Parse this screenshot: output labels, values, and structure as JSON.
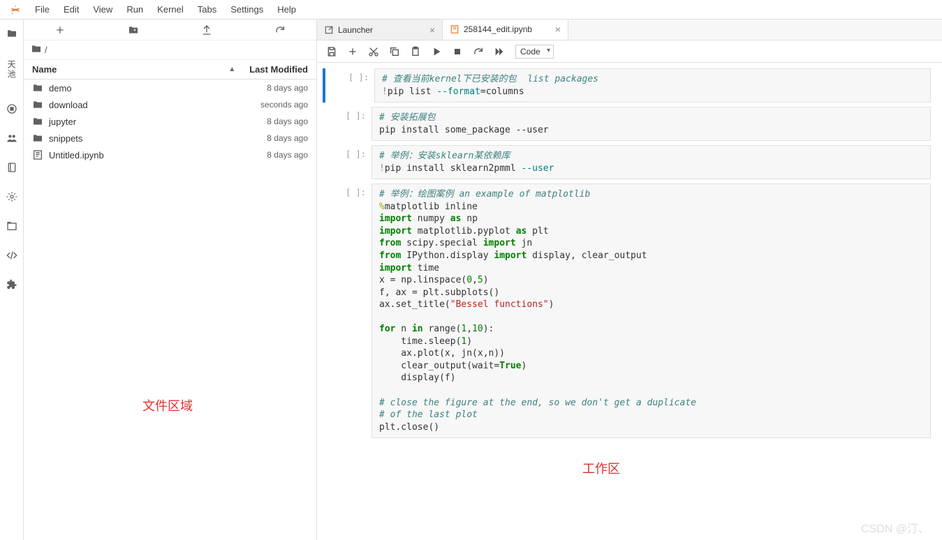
{
  "menu": {
    "items": [
      "File",
      "Edit",
      "View",
      "Run",
      "Kernel",
      "Tabs",
      "Settings",
      "Help"
    ]
  },
  "leftbar": {
    "label": "天池"
  },
  "filebrowser": {
    "crumb": "/",
    "header_name": "Name",
    "header_mod": "Last Modified",
    "rows": [
      {
        "icon": "folder",
        "name": "demo",
        "mod": "8 days ago"
      },
      {
        "icon": "folder",
        "name": "download",
        "mod": "seconds ago"
      },
      {
        "icon": "folder",
        "name": "jupyter",
        "mod": "8 days ago"
      },
      {
        "icon": "folder",
        "name": "snippets",
        "mod": "8 days ago"
      },
      {
        "icon": "notebook",
        "name": "Untitled.ipynb",
        "mod": "8 days ago"
      }
    ]
  },
  "tabs": [
    {
      "icon": "launch",
      "label": "Launcher",
      "active": false
    },
    {
      "icon": "notebook",
      "label": "258144_edit.ipynb",
      "active": true
    }
  ],
  "toolbar": {
    "celltype_selected": "Code"
  },
  "annotations": {
    "file_area": "文件区域",
    "work_area": "工作区"
  },
  "watermark": "CSDN @汀、",
  "cells": [
    {
      "prompt": "[ ]:",
      "running": true,
      "html": "<span class='c-cm'># 查看当前kernel下已安装的包  list packages</span>\n<span class='c-bang'>!</span>pip list <span class='c-teal'>--format</span>=columns"
    },
    {
      "prompt": "[ ]:",
      "html": "<span class='c-cm'># 安装拓展包</span>\npip install some_package --user"
    },
    {
      "prompt": "[ ]:",
      "html": "<span class='c-cm'># 举例：安装sklearn某依赖库</span>\n<span class='c-bang'>!</span>pip install sklearn2pmml <span class='c-teal'>--user</span>"
    },
    {
      "prompt": "[ ]:",
      "html": "<span class='c-cm'># 举例：绘图案例 an example of matplotlib</span>\n<span class='c-mg'>%</span>matplotlib inline\n<span class='c-kw'>import</span> numpy <span class='c-kw'>as</span> np\n<span class='c-kw'>import</span> matplotlib.pyplot <span class='c-kw'>as</span> plt\n<span class='c-kw'>from</span> scipy.special <span class='c-kw'>import</span> jn\n<span class='c-kw'>from</span> IPython.display <span class='c-kw'>import</span> display, clear_output\n<span class='c-kw'>import</span> time\nx <span class='c-op'>=</span> np.linspace(<span class='c-num'>0</span>,<span class='c-num'>5</span>)\nf, ax <span class='c-op'>=</span> plt.subplots()\nax.set_title(<span class='c-st'>\"Bessel functions\"</span>)\n\n<span class='c-kw'>for</span> n <span class='c-kw'>in</span> range(<span class='c-num'>1</span>,<span class='c-num'>10</span>):\n    time.sleep(<span class='c-num'>1</span>)\n    ax.plot(x, jn(x,n))\n    clear_output(wait=<span class='c-kw'>True</span>)\n    display(f)\n\n<span class='c-cm'># close the figure at the end, so we don't get a duplicate</span>\n<span class='c-cm'># of the last plot</span>\nplt.close()"
    }
  ]
}
